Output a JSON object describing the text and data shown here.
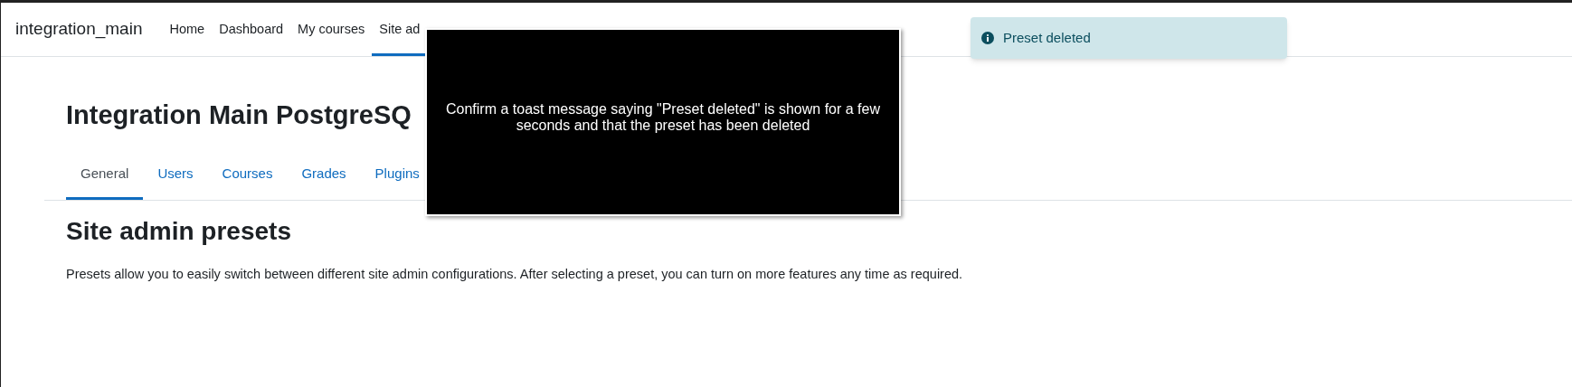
{
  "navbar": {
    "brand": "integration_main",
    "items": [
      {
        "label": "Home",
        "selected": false
      },
      {
        "label": "Dashboard",
        "selected": false
      },
      {
        "label": "My courses",
        "selected": false
      },
      {
        "label": "Site ad",
        "selected": true
      }
    ]
  },
  "page": {
    "heading": "Integration Main PostgreSQ",
    "tabs": [
      {
        "label": "General",
        "selected": true
      },
      {
        "label": "Users",
        "selected": false
      },
      {
        "label": "Courses",
        "selected": false
      },
      {
        "label": "Grades",
        "selected": false
      },
      {
        "label": "Plugins",
        "selected": false
      }
    ],
    "section_title": "Site admin presets",
    "description": "Presets allow you to easily switch between different site admin configurations. After selecting a preset, you can turn on more features any time as required."
  },
  "toast": {
    "message": "Preset deleted"
  },
  "instruction_overlay": {
    "text": "Confirm a toast message saying \"Preset deleted\" is shown for a few seconds and that the preset has been deleted"
  }
}
